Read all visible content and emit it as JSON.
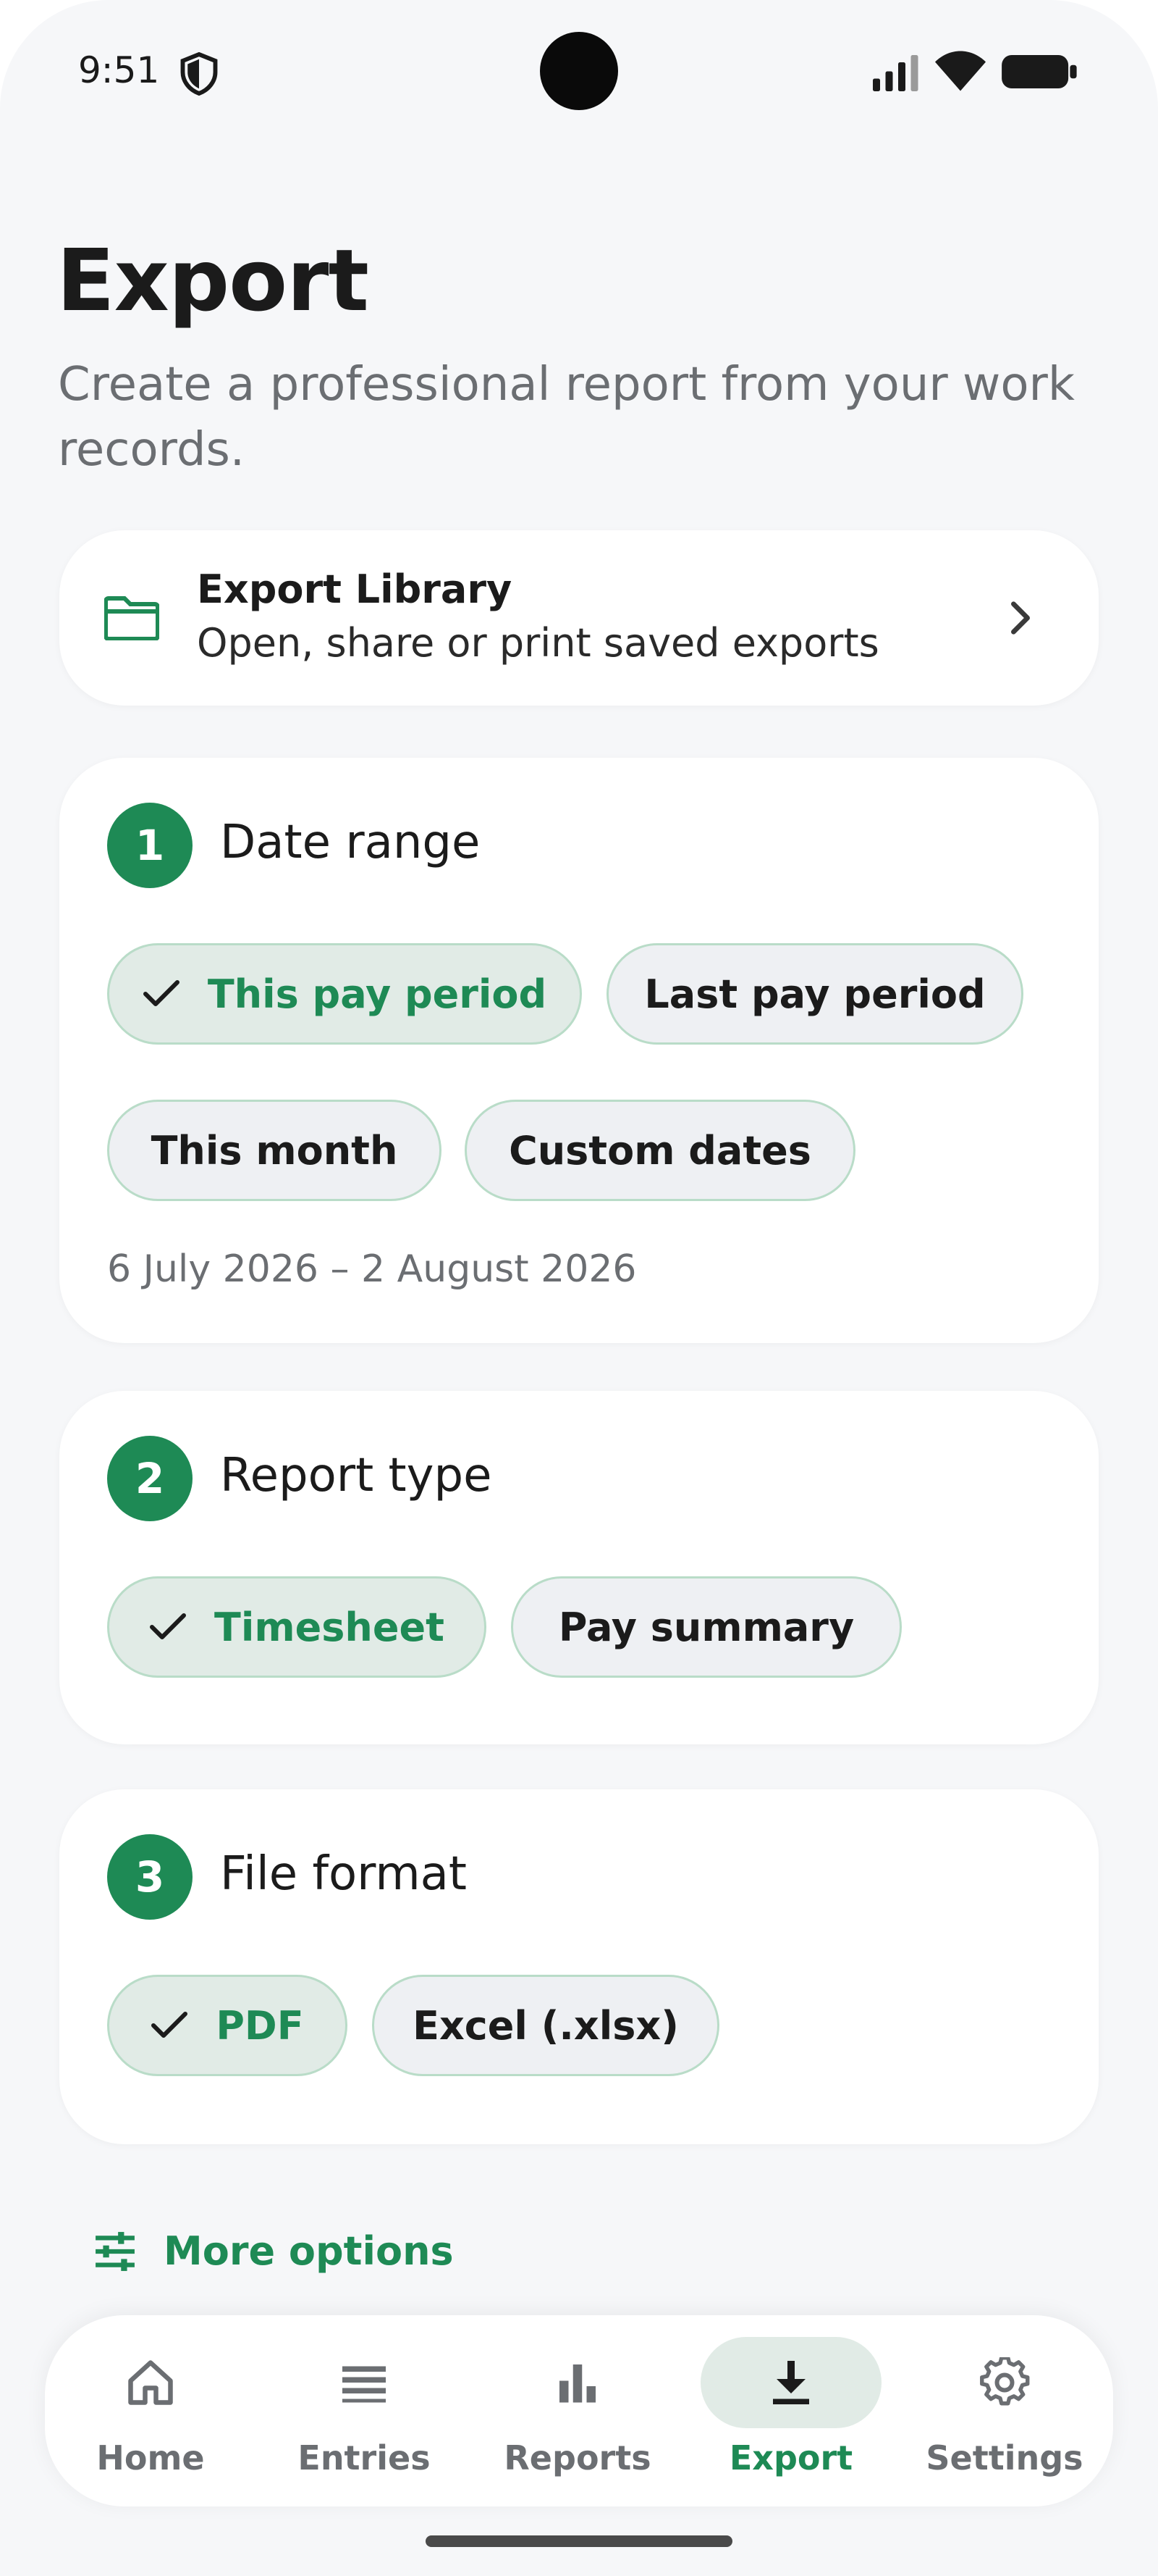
{
  "status_bar": {
    "time": "9:51",
    "icons": [
      "shield-icon",
      "signal-icon",
      "wifi-icon",
      "battery-icon"
    ]
  },
  "header": {
    "title": "Export",
    "subtitle": "Create a professional report from your work records."
  },
  "library": {
    "icon": "folder-icon",
    "title": "Export Library",
    "subtitle": "Open, share or print saved exports"
  },
  "date_range": {
    "step": "1",
    "title": "Date range",
    "options": [
      {
        "label": "This pay period",
        "selected": true
      },
      {
        "label": "Last pay period",
        "selected": false
      },
      {
        "label": "This month",
        "selected": false
      },
      {
        "label": "Custom dates",
        "selected": false
      }
    ],
    "range_text": "6 July 2026 – 2 August 2026"
  },
  "report_type": {
    "step": "2",
    "title": "Report type",
    "options": [
      {
        "label": "Timesheet",
        "selected": true
      },
      {
        "label": "Pay summary",
        "selected": false
      }
    ]
  },
  "file_format": {
    "step": "3",
    "title": "File format",
    "options": [
      {
        "label": "PDF",
        "selected": true
      },
      {
        "label": "Excel (.xlsx)",
        "selected": false
      }
    ]
  },
  "more_options": {
    "icon": "tune-icon",
    "label": "More options"
  },
  "bottom_nav": {
    "items": [
      {
        "label": "Home",
        "icon": "home-icon",
        "active": false
      },
      {
        "label": "Entries",
        "icon": "list-icon",
        "active": false
      },
      {
        "label": "Reports",
        "icon": "bar-chart-icon",
        "active": false
      },
      {
        "label": "Export",
        "icon": "download-icon",
        "active": true
      },
      {
        "label": "Settings",
        "icon": "gear-icon",
        "active": false
      }
    ]
  },
  "colors": {
    "accent": "#1e8a55",
    "selected_chip_bg": "#e1ebe6",
    "chip_bg": "#eef0f3",
    "chip_border": "#b9dcc8",
    "text_primary": "#1b1b1b",
    "text_secondary": "#6b6e72",
    "page_bg": "#f6f7f9"
  }
}
